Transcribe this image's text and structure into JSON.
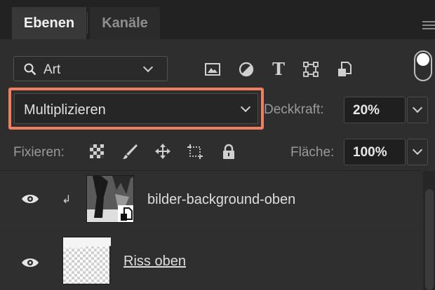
{
  "panel": {
    "tabs": [
      {
        "label": "Ebenen",
        "active": true
      },
      {
        "label": "Kanäle",
        "active": false
      }
    ],
    "menu_icon": "hamburger-menu-icon"
  },
  "filter": {
    "kind_label": "Art",
    "kind_icon": "search-icon",
    "icons": [
      "image-filter-icon",
      "adjustment-filter-icon",
      "type-filter-icon",
      "shape-filter-icon",
      "smart-object-filter-icon"
    ],
    "type_glyph": "T",
    "toggle_on": true
  },
  "blend": {
    "mode": "Multiplizieren",
    "opacity_label": "Deckkraft:",
    "opacity_value": "20%",
    "highlight_color": "#ef7f5f"
  },
  "lock": {
    "label": "Fixieren:",
    "icons": [
      "lock-transparent-pixels-icon",
      "lock-image-pixels-icon",
      "lock-position-icon",
      "lock-artboard-icon",
      "lock-all-icon"
    ],
    "fill_label": "Fläche:",
    "fill_value": "100%"
  },
  "layers": [
    {
      "name": "bilder-background-oben",
      "visible": true,
      "clipped": true,
      "smart_object": true,
      "underlined": false
    },
    {
      "name": "Riss oben",
      "visible": true,
      "clipped": false,
      "smart_object": false,
      "underlined": true
    }
  ],
  "colors": {
    "panel_bg": "#2e2e2e",
    "tab_bar_bg": "#222222",
    "accent_outline": "#ef7f5f"
  }
}
